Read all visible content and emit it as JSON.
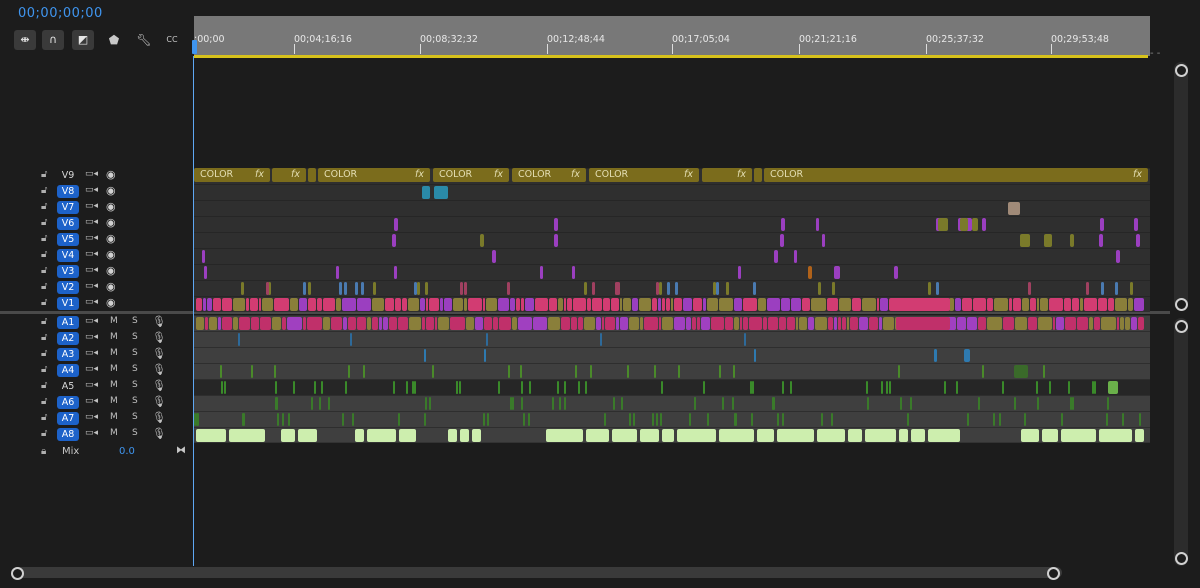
{
  "timecode": "00;00;00;00",
  "toolbar": {
    "tools": [
      "insert-snap-icon",
      "magnet-icon",
      "linked-selection-icon",
      "marker-icon",
      "wrench-icon",
      "captions-icon"
    ],
    "captions_label": "CC"
  },
  "ruler": {
    "labels": [
      ";00;00",
      "00;04;16;16",
      "00;08;32;32",
      "00;12;48;44",
      "00;17;05;04",
      "00;21;21;16",
      "00;25;37;32",
      "00;29;53;48"
    ]
  },
  "video_tracks": [
    {
      "name": "V9",
      "targeted": false
    },
    {
      "name": "V8",
      "targeted": true
    },
    {
      "name": "V7",
      "targeted": true
    },
    {
      "name": "V6",
      "targeted": true
    },
    {
      "name": "V5",
      "targeted": true
    },
    {
      "name": "V4",
      "targeted": true
    },
    {
      "name": "V3",
      "targeted": true
    },
    {
      "name": "V2",
      "targeted": true
    },
    {
      "name": "V1",
      "targeted": true
    }
  ],
  "audio_tracks": [
    {
      "name": "A1",
      "targeted": true
    },
    {
      "name": "A2",
      "targeted": true
    },
    {
      "name": "A3",
      "targeted": true
    },
    {
      "name": "A4",
      "targeted": true
    },
    {
      "name": "A5",
      "targeted": false
    },
    {
      "name": "A6",
      "targeted": true
    },
    {
      "name": "A7",
      "targeted": true
    },
    {
      "name": "A8",
      "targeted": true
    }
  ],
  "track_controls": {
    "mute": "M",
    "solo": "S"
  },
  "color_clips": [
    {
      "label": "COLOR",
      "fx": "fx"
    },
    {
      "label": "",
      "fx": "fx"
    },
    {
      "label": "COLOR",
      "fx": "fx"
    },
    {
      "label": "COLOR",
      "fx": "fx"
    },
    {
      "label": "COLOR",
      "fx": "fx"
    },
    {
      "label": "COLOR",
      "fx": "fx"
    },
    {
      "label": "",
      "fx": "fx"
    },
    {
      "label": "COLOR",
      "fx": "fx"
    }
  ],
  "mix": {
    "label": "Mix",
    "value": "0.0"
  },
  "colors": {
    "accent": "#3f95ef",
    "track_target": "#1d62c9",
    "color_clip": "#7b6c1c",
    "v1_pink": "#d23c72",
    "v1_olive": "#8a7f3a",
    "purple": "#9b3fc0",
    "audio_green": "#cdeeae"
  }
}
